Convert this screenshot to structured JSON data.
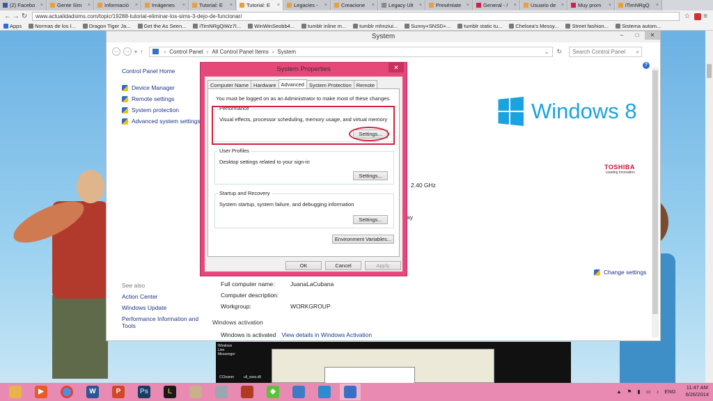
{
  "browser": {
    "tabs": [
      {
        "label": "(2) Facebo",
        "active": false
      },
      {
        "label": "Gente Sim",
        "active": false
      },
      {
        "label": "Informació",
        "active": false
      },
      {
        "label": "Imágenes",
        "active": false
      },
      {
        "label": "Tutorial: E",
        "active": false
      },
      {
        "label": "Tutorial: E",
        "active": true
      },
      {
        "label": "Legacies -",
        "active": false
      },
      {
        "label": "Creacione",
        "active": false
      },
      {
        "label": "Legacy Ult",
        "active": false
      },
      {
        "label": "Preséntate",
        "active": false
      },
      {
        "label": "General - /",
        "active": false
      },
      {
        "label": "Usuario de",
        "active": false
      },
      {
        "label": "Muy prom",
        "active": false
      },
      {
        "label": "iTimNRgQ",
        "active": false
      }
    ],
    "url": "www.actualidadsims.com/topic/19288-tutorial-eliminar-los-sims-3-dejo-de-funcionar/",
    "bookmarks": [
      "Apps",
      "Normas de los I...",
      "Dragon Tiger Ja...",
      "Get the As Seen...",
      "iTimNRgQiWz7I...",
      "WinWinSeobb4...",
      "tumblr inline m...",
      "tumblr mhnziui...",
      "Sunny+SNSD+...",
      "tumblr static tu...",
      "Chelsea's Messy...",
      "Street fashion...",
      "Sistema autom..."
    ]
  },
  "system_window": {
    "title": "System",
    "breadcrumb": [
      "Control Panel",
      "All Control Panel Items",
      "System"
    ],
    "search_placeholder": "Search Control Panel",
    "left_nav": {
      "home": "Control Panel Home",
      "items": [
        "Device Manager",
        "Remote settings",
        "System protection",
        "Advanced system settings"
      ]
    },
    "see_also": {
      "heading": "See also",
      "items": [
        "Action Center",
        "Windows Update",
        "Performance Information and Tools"
      ]
    },
    "logo_text": "Windows",
    "logo_version": "8",
    "oem_name": "TOSHIBA",
    "oem_tagline": "Leading Innovation",
    "speed_fragment": "2.40 GHz",
    "ay_fragment": "ay",
    "change_settings": "Change settings",
    "computer_info": [
      {
        "label": "Full computer name:",
        "value": "JuanaLaCubana"
      },
      {
        "label": "Computer description:",
        "value": ""
      },
      {
        "label": "Workgroup:",
        "value": "WORKGROUP"
      }
    ],
    "activation_heading": "Windows activation",
    "activation_status": "Windows is activated",
    "activation_link": "View details in Windows Activation"
  },
  "dialog": {
    "title": "System Properties",
    "tabs": [
      "Computer Name",
      "Hardware",
      "Advanced",
      "System Protection",
      "Remote"
    ],
    "active_tab": "Advanced",
    "admin_note": "You must be logged on as an Administrator to make most of these changes.",
    "groups": [
      {
        "title": "Performance",
        "desc": "Visual effects, processor scheduling, memory usage, and virtual memory",
        "button": "Settings..."
      },
      {
        "title": "User Profiles",
        "desc": "Desktop settings related to your sign-in",
        "button": "Settings..."
      },
      {
        "title": "Startup and Recovery",
        "desc": "System startup, system failure, and debugging information",
        "button": "Settings..."
      }
    ],
    "env_button": "Environment Variables...",
    "ok": "OK",
    "cancel": "Cancel",
    "apply": "Apply",
    "highlight_color": "#d0203a",
    "frame_color": "#e6487a"
  },
  "preview": {
    "app_label": "Windows Live Messenger",
    "file1": "CCleaner",
    "file2": "ull_osso.dll"
  },
  "taskbar": {
    "language": "ENG",
    "time": "11:47 AM",
    "date": "6/26/2014",
    "apps": [
      "file-explorer-icon",
      "media-player-icon",
      "chrome-icon",
      "word-icon",
      "powerpoint-icon",
      "photoshop-icon",
      "league-of-legends-icon",
      "paint-icon",
      "photos-icon",
      "game-icon",
      "sims-icon",
      "screen-icon",
      "network-icon",
      "control-panel-icon"
    ]
  }
}
